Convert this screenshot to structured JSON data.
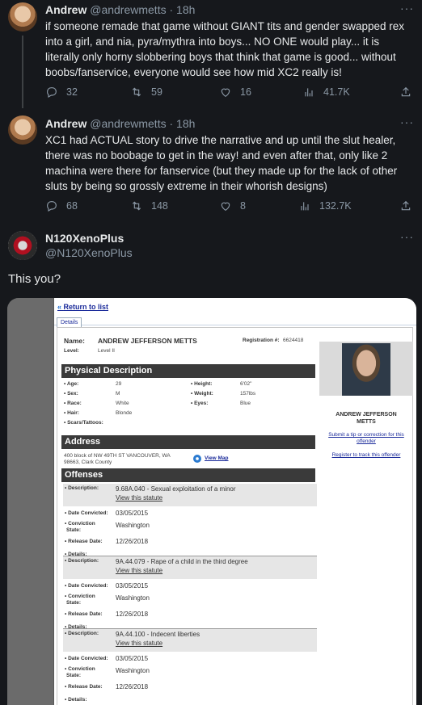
{
  "tweets": [
    {
      "name": "Andrew",
      "handle_time": "@andrewmetts · 18h",
      "more": "···",
      "text": "if someone remade that game without GIANT tits and gender swapped rex into a girl, and nia, pyra/mythra into boys... NO ONE would play... it is literally only horny slobbering boys that think that game is good... without boobs/fanservice, everyone would see how mid XC2 really is!",
      "replies": "32",
      "retweets": "59",
      "likes": "16",
      "views": "41.7K"
    },
    {
      "name": "Andrew",
      "handle_time": "@andrewmetts · 18h",
      "more": "···",
      "text": "XC1 had ACTUAL story to drive the narrative and up until the slut healer, there was no boobage to get in the way! and even after that, only like 2 machina were there for fanservice (but they made up for the lack of other sluts by being so grossly extreme in their whorish designs)",
      "replies": "68",
      "retweets": "148",
      "likes": "8",
      "views": "132.7K"
    }
  ],
  "reply": {
    "name": "N120XenoPlus",
    "handle": "@N120XenoPlus",
    "more": "···",
    "text": "This you?"
  },
  "record": {
    "return_link": "Return to list",
    "return_arrow": "«",
    "tab": "Details",
    "name_label": "Name:",
    "name_value": "ANDREW JEFFERSON METTS",
    "level_label": "Level:",
    "level_value": "Level II",
    "registration_label": "Registration #:",
    "registration_value": "6624418",
    "physical_title": "Physical Description",
    "age_label": "• Age:",
    "age_value": "29",
    "sex_label": "• Sex:",
    "sex_value": "M",
    "race_label": "• Race:",
    "race_value": "White",
    "hair_label": "• Hair:",
    "hair_value": "Blonde",
    "scars_label": "• Scars/Tattoos:",
    "height_label": "• Height:",
    "height_value": "6'02\"",
    "weight_label": "• Weight:",
    "weight_value": "157lbs",
    "eyes_label": "• Eyes:",
    "eyes_value": "Blue",
    "address_title": "Address",
    "address_line1": "400 block of NW 49TH ST VANCOUVER, WA",
    "address_line2": "98663, Clark County",
    "view_map": "View Map",
    "offenses_title": "Offenses",
    "photo_caption_1": "ANDREW JEFFERSON",
    "photo_caption_2": "METTS",
    "tip_link_1": "Submit a tip or correction for this",
    "tip_link_2": "offender",
    "track_link": "Register to track this offender",
    "labels": {
      "description": "• Description:",
      "date_convicted": "• Date Convicted:",
      "conviction": "• Conviction",
      "state": "State:",
      "release_date": "• Release Date:",
      "details": "• Details:"
    },
    "view_statute": "View this statute",
    "offenses": [
      {
        "description": "9.68A.040 - Sexual exploitation of a minor",
        "date_convicted": "03/05/2015",
        "state": "Washington",
        "release_date": "12/26/2018"
      },
      {
        "description": "9A.44.079 - Rape of a child in the third degree",
        "date_convicted": "03/05/2015",
        "state": "Washington",
        "release_date": "12/26/2018"
      },
      {
        "description": "9A.44.100 - Indecent liberties",
        "date_convicted": "03/05/2015",
        "state": "Washington",
        "release_date": "12/26/2018"
      }
    ]
  }
}
